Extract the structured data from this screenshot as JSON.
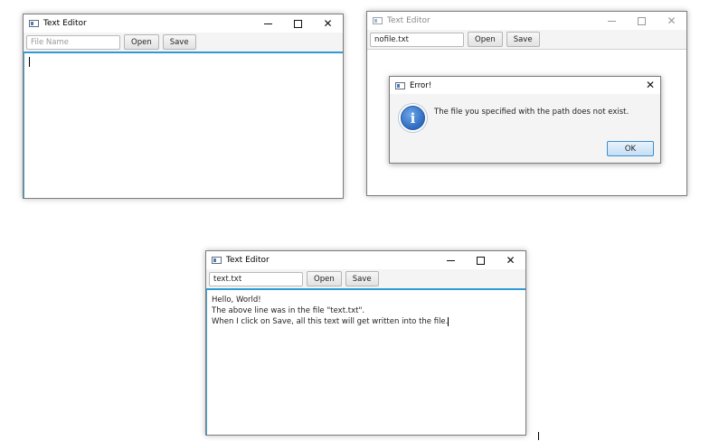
{
  "window_a": {
    "title": "Text Editor",
    "file_placeholder": "File Name",
    "file_value": "",
    "open_label": "Open",
    "save_label": "Save"
  },
  "window_b": {
    "title": "Text Editor",
    "file_value": "nofile.txt",
    "open_label": "Open",
    "save_label": "Save",
    "dialog": {
      "title": "Error!",
      "message": "The file you specified with the path does not exist.",
      "ok_label": "OK",
      "icon": "info-icon"
    }
  },
  "window_c": {
    "title": "Text Editor",
    "file_value": "text.txt",
    "open_label": "Open",
    "save_label": "Save",
    "content_lines": [
      "Hello, World!",
      "The above line was in the file \"text.txt\".",
      "When I click on Save, all this text will get written into the file."
    ]
  },
  "icons": {
    "minimize": "minimize-icon",
    "maximize": "maximize-icon",
    "close": "close-icon"
  },
  "colors": {
    "focus_accent": "#2f9ad6",
    "info_blue": "#2d6bc1"
  }
}
